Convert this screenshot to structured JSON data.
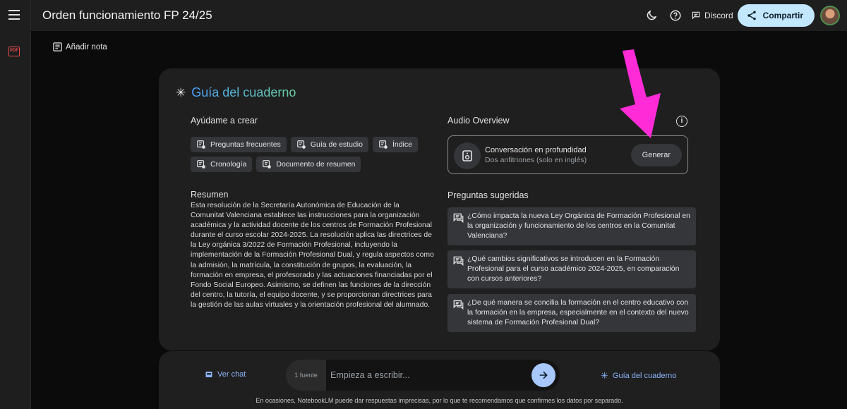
{
  "header": {
    "title": "Orden funcionamiento FP 24/25",
    "discord_label": "Discord",
    "share_label": "Compartir"
  },
  "sidebar": {
    "pdf_label": "PDF"
  },
  "add_note_label": "Añadir nota",
  "guide": {
    "title": "Guía del cuaderno",
    "help_create_label": "Ayúdame a crear",
    "chips": [
      "Preguntas frecuentes",
      "Guía de estudio",
      "Índice",
      "Cronología",
      "Documento de resumen"
    ],
    "summary_title": "Resumen",
    "summary_text": "Esta resolución de la Secretaría Autonómica de Educación de la Comunitat Valenciana establece las instrucciones para la organización académica y la actividad docente de los centros de Formación Profesional durante el curso escolar 2024-2025. La resolución aplica las directrices de la Ley orgánica 3/2022 de Formación Profesional, incluyendo la implementación de la Formación Profesional Dual, y regula aspectos como la admisión, la matrícula, la constitución de grupos, la evaluación, la formación en empresa, el profesorado y las actuaciones financiadas por el Fondo Social Europeo. Asimismo, se definen las funciones de la dirección del centro, la tutoría, el equipo docente, y se proporcionan directrices para la gestión de las aulas virtuales y la orientación profesional del alumnado.",
    "audio": {
      "label": "Audio Overview",
      "title": "Conversación en profundidad",
      "subtitle": "Dos anfitriones (solo en inglés)",
      "generate_label": "Generar"
    },
    "suggested_label": "Preguntas sugeridas",
    "questions": [
      "¿Cómo impacta la nueva Ley Orgánica de Formación Profesional en la organización y funcionamiento de los centros en la Comunitat Valenciana?",
      "¿Qué cambios significativos se introducen en la Formación Profesional para el curso académico 2024-2025, en comparación con cursos anteriores?",
      "¿De qué manera se concilia la formación en el centro educativo con la formación en la empresa, especialmente en el contexto del nuevo sistema de Formación Profesional Dual?"
    ]
  },
  "chat": {
    "view_chat_label": "Ver chat",
    "source_count": "1 fuente",
    "placeholder": "Empieza a escribir...",
    "guide_link_label": "Guía del cuaderno",
    "disclaimer": "En ocasiones, NotebookLM puede dar respuestas imprecisas, por lo que te recomendamos que confirmes los datos por separado."
  },
  "colors": {
    "accent": "#a8c7fa",
    "share_bg": "#c2e7ff",
    "annotation_arrow": "#ff2bd6"
  }
}
